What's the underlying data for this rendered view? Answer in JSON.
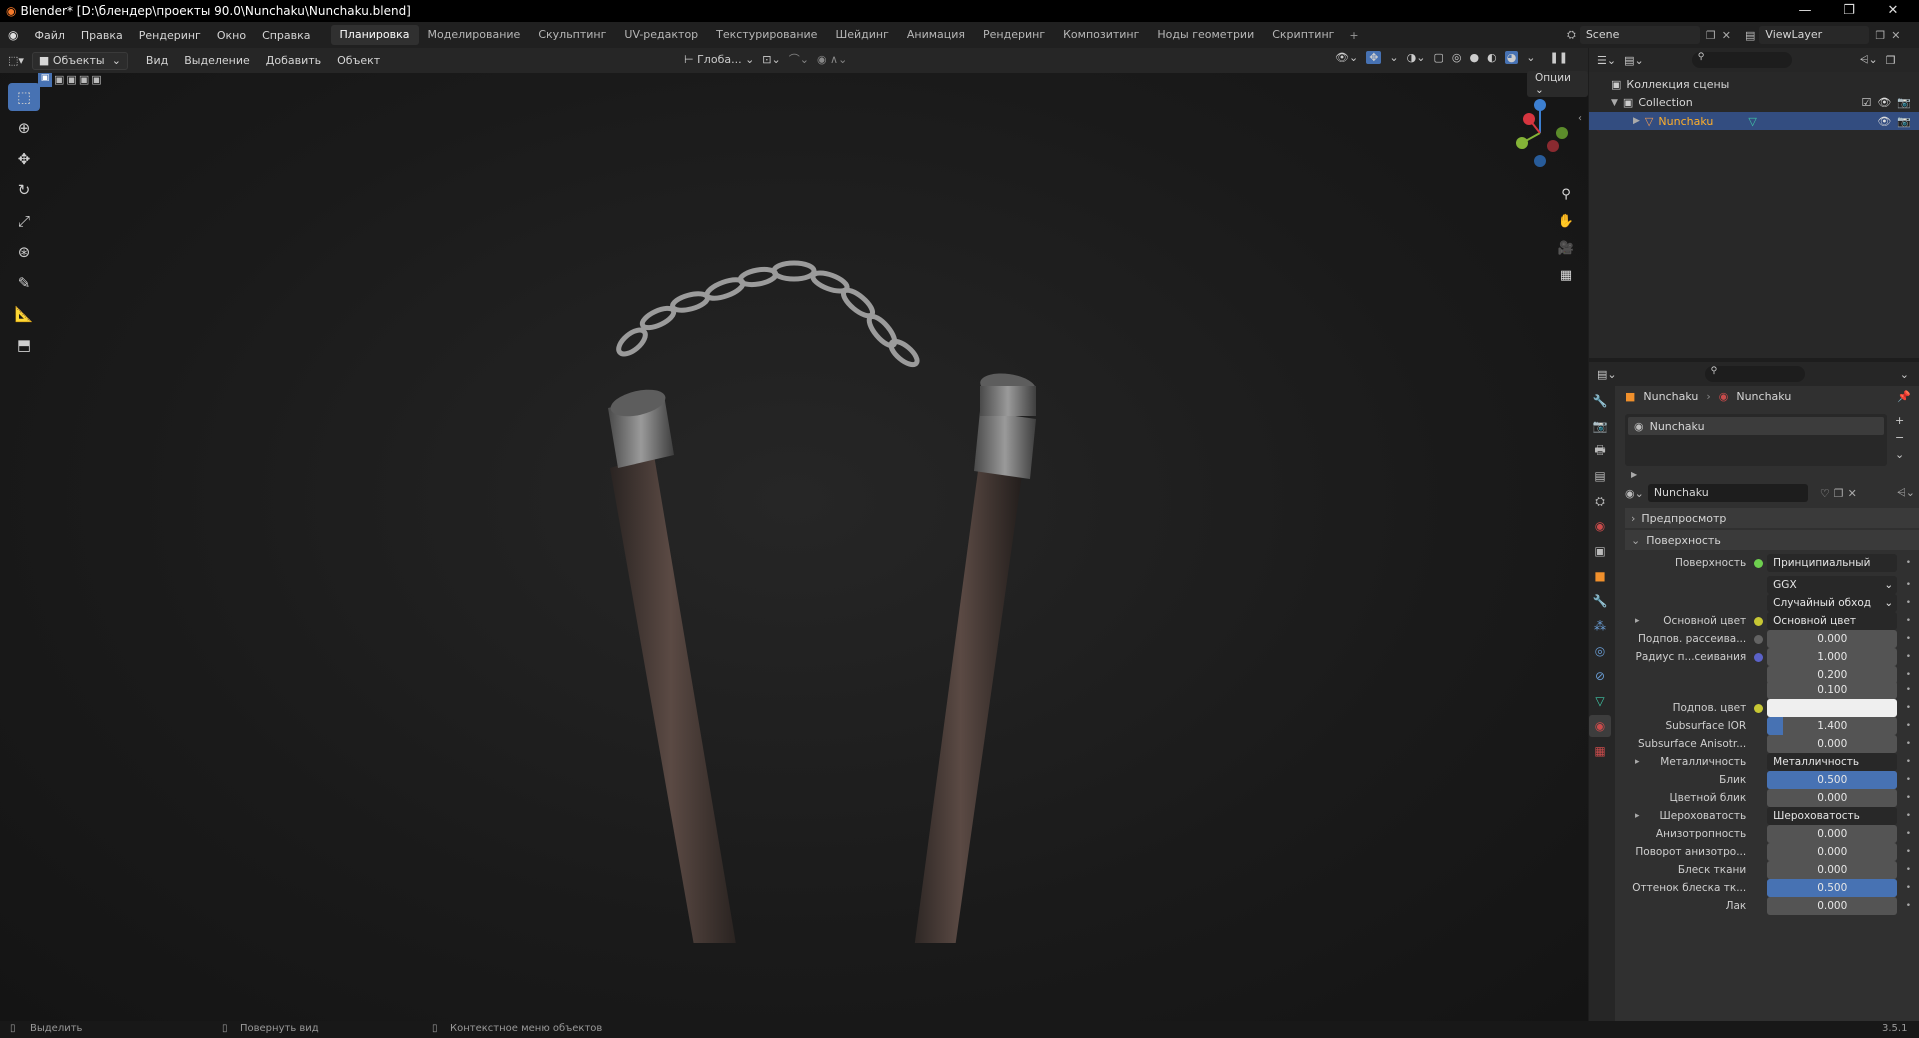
{
  "title": "Blender* [D:\\блендер\\проекты 90.0\\Nunchaku\\Nunchaku.blend]",
  "menu": [
    "Файл",
    "Правка",
    "Рендеринг",
    "Окно",
    "Справка"
  ],
  "workspaces": [
    "Планировка",
    "Моделирование",
    "Скульптинг",
    "UV-редактор",
    "Текстурирование",
    "Шейдинг",
    "Анимация",
    "Рендеринг",
    "Композитинг",
    "Ноды геометрии",
    "Скриптинг"
  ],
  "active_workspace": "Планировка",
  "scene": "Scene",
  "view_layer": "ViewLayer",
  "header3d": {
    "mode": "Объекты",
    "menus": [
      "Вид",
      "Выделение",
      "Добавить",
      "Объект"
    ],
    "transform": "Глоба...",
    "options": "Опции"
  },
  "outliner": {
    "root": "Коллекция сцены",
    "collection": "Collection",
    "object": "Nunchaku"
  },
  "props": {
    "breadcrumb": [
      "Nunchaku",
      "Nunchaku"
    ],
    "slot": "Nunchaku",
    "material": "Nunchaku",
    "panels": {
      "preview": "Предпросмотр",
      "surface": "Поверхность"
    },
    "rows": [
      {
        "label": "Поверхность",
        "value": "Принципиальный BSDF",
        "dot": "green",
        "type": "dark"
      },
      {
        "label": "",
        "value": "GGX",
        "type": "dark",
        "dropdown": true
      },
      {
        "label": "",
        "value": "Случайный обход",
        "type": "dark",
        "dropdown": true
      },
      {
        "label": "Основной цвет",
        "value": "Основной цвет",
        "dot": "yellow",
        "type": "dark",
        "arrow": true
      },
      {
        "label": "Подпов. рассеива...",
        "value": "0.000",
        "dot": "grey"
      },
      {
        "label": "Радиус п...сеивания",
        "value": "1.000",
        "dot": "purple"
      },
      {
        "label": "",
        "value": "0.200"
      },
      {
        "label": "",
        "value": "0.100"
      },
      {
        "label": "Подпов. цвет",
        "value": "",
        "dot": "yellow",
        "type": "white"
      },
      {
        "label": "Subsurface IOR",
        "value": "1.400",
        "fill": 0.12
      },
      {
        "label": "Subsurface Anisotr...",
        "value": "0.000"
      },
      {
        "label": "Металличность",
        "value": "Металличность",
        "type": "dark",
        "arrow": true
      },
      {
        "label": "Блик",
        "value": "0.500",
        "fill": 1
      },
      {
        "label": "Цветной блик",
        "value": "0.000"
      },
      {
        "label": "Шероховатость",
        "value": "Шероховатость",
        "type": "dark",
        "arrow": true
      },
      {
        "label": "Анизотропность",
        "value": "0.000"
      },
      {
        "label": "Поворот анизотро...",
        "value": "0.000"
      },
      {
        "label": "Блеск ткани",
        "value": "0.000"
      },
      {
        "label": "Оттенок блеска тк...",
        "value": "0.500",
        "fill": 1
      },
      {
        "label": "Лак",
        "value": "0.000"
      }
    ]
  },
  "status": {
    "select": "Выделить",
    "rotate": "Повернуть вид",
    "context": "Контекстное меню объектов",
    "version": "3.5.1"
  }
}
